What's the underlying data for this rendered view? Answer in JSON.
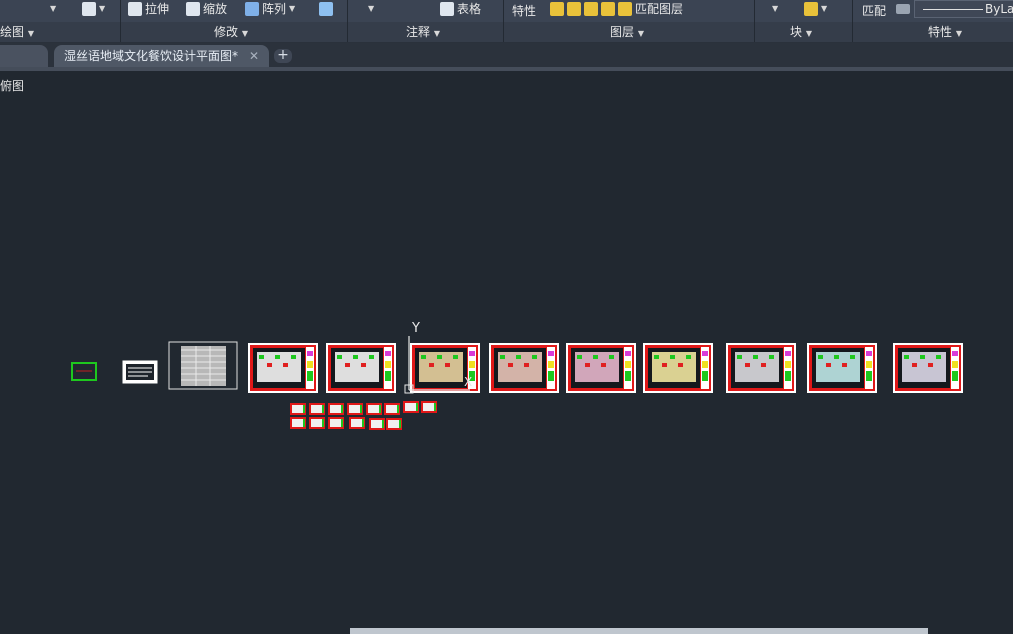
{
  "ribbon": {
    "stretch_label": "拉伸",
    "scale_label": "缩放",
    "array_label": "阵列",
    "table_label": "表格",
    "properties_label": "特性",
    "match_layer_label": "匹配图层",
    "match_label": "匹配",
    "lineweight_value": "ByLay",
    "panels": {
      "draw": "绘图",
      "modify": "修改",
      "annotation": "注释",
      "layers": "图层",
      "block": "块",
      "properties": "特性"
    }
  },
  "tabs": {
    "active_tab_label": "湿丝语地域文化餐饮设计平面图*",
    "add_tab": "+"
  },
  "viewport": {
    "view_label": "俯图",
    "ucs_y_label": "Y",
    "ucs_x_label": "X"
  },
  "colors": {
    "canvas_bg": "#212830",
    "frame_red": "#e01818",
    "frame_white": "#ffffff",
    "accent_green": "#1ec81e",
    "accent_yellow": "#f0e020"
  }
}
